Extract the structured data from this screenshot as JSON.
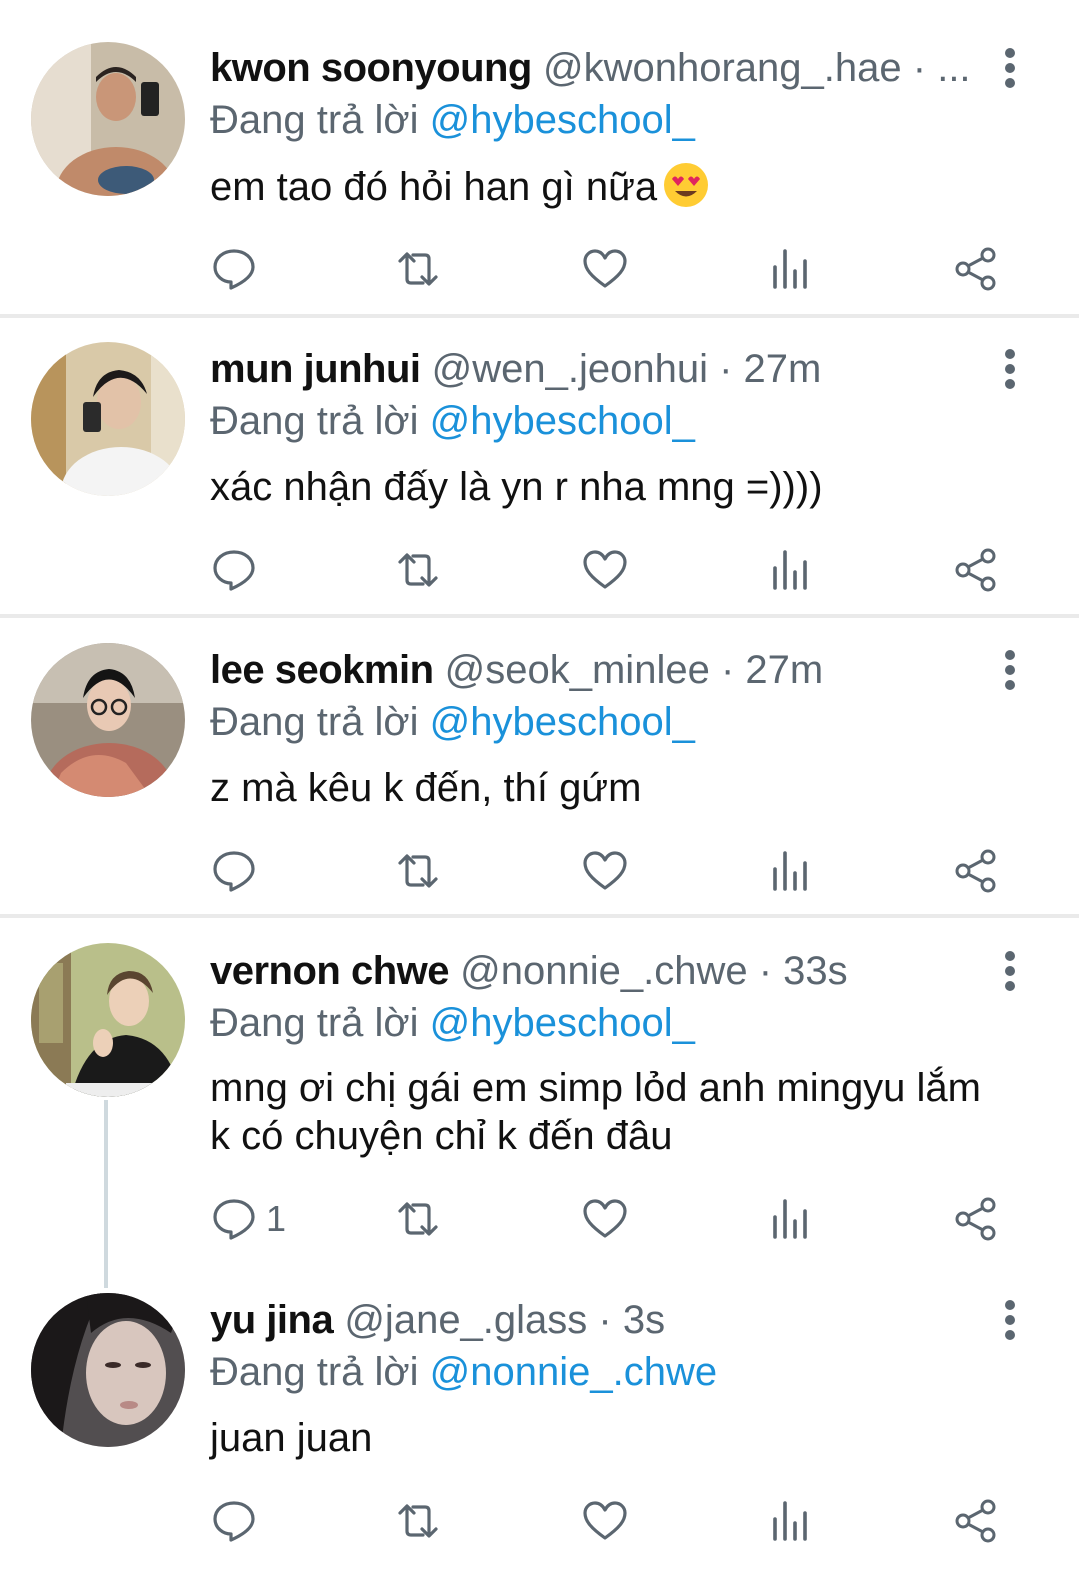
{
  "colors": {
    "mention": "#1a91da",
    "secondary_text": "#5b6670",
    "primary_text": "#111111",
    "divider": "#eaeaea"
  },
  "reply_label": "Đang trả lời",
  "tweets": [
    {
      "name": "kwon soonyoung",
      "handle": "@kwonhorang_.hae",
      "time": "· ...",
      "reply_to": "@hybeschool_",
      "text": "em tao đó hỏi han gì nữa",
      "emoji": "heart-eyes-emoji",
      "reply_count": ""
    },
    {
      "name": "mun junhui",
      "handle": "@wen_.jeonhui",
      "time": "· 27m",
      "reply_to": "@hybeschool_",
      "text": "xác nhận đấy là yn r nha mng =))))",
      "reply_count": ""
    },
    {
      "name": "lee seokmin",
      "handle": "@seok_minlee",
      "time": "· 27m",
      "reply_to": "@hybeschool_",
      "text": "z mà kêu k đến, thí gứm",
      "reply_count": ""
    },
    {
      "name": "vernon chwe",
      "handle": "@nonnie_.chwe",
      "time": "· 33s",
      "reply_to": "@hybeschool_",
      "text_line1": "mng ơi chị gái em simp lỏd anh mingyu lắm",
      "text_line2": "k có chuyện chỉ k đến đâu",
      "reply_count": "1"
    },
    {
      "name": "yu jina",
      "handle": "@jane_.glass",
      "time": "· 3s",
      "reply_to": "@nonnie_.chwe",
      "text": "juan juan",
      "reply_count": ""
    }
  ],
  "icons": [
    "reply-icon",
    "retweet-icon",
    "like-icon",
    "views-icon",
    "share-icon",
    "more-icon"
  ]
}
